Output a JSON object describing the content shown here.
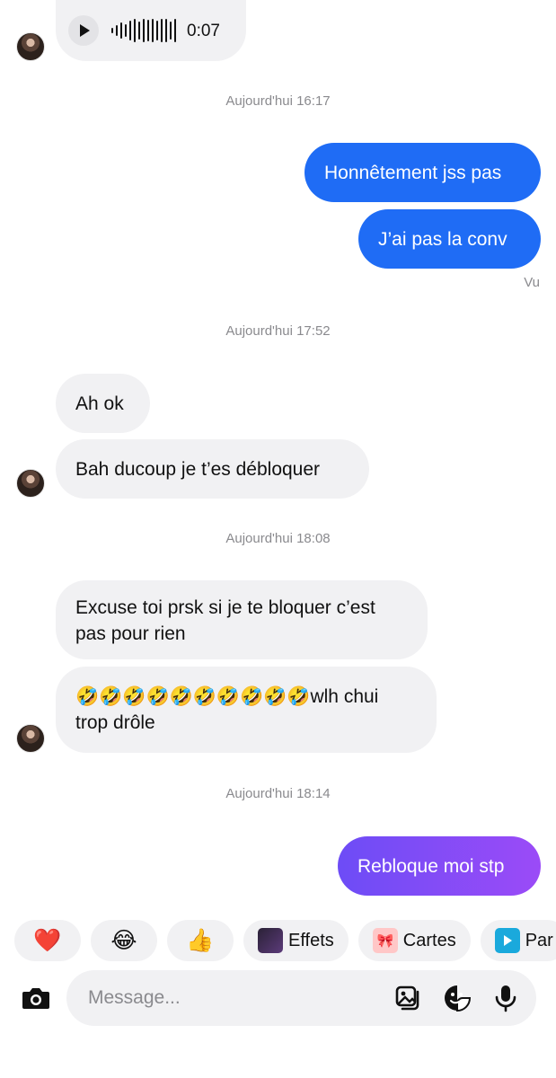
{
  "voice_message": {
    "duration": "0:07"
  },
  "timestamps": [
    "Aujourd'hui 16:17",
    "Aujourd'hui 17:52",
    "Aujourd'hui 18:08",
    "Aujourd'hui 18:14"
  ],
  "messages": {
    "m1": "Honnêtement jss pas",
    "m2": "J’ai pas la conv",
    "seen": "Vu",
    "m3": "Ah ok",
    "m4": "Bah ducoup je t’es débloquer",
    "m5_line1": "Excuse toi prsk si je te bloquer c’est",
    "m5_line2": "pas pour rien",
    "m6_line1": "🤣🤣🤣🤣🤣🤣🤣🤣🤣🤣wlh chui",
    "m6_line2": "trop drôle",
    "m7": "Rebloque moi stp"
  },
  "reactions": {
    "heart": "❤️",
    "laugh": "😂",
    "thumbs": "👍",
    "effets": "Effets",
    "cartes": "Cartes",
    "par": "Par"
  },
  "composer": {
    "placeholder": "Message...",
    "icons": [
      "camera-icon",
      "gallery-icon",
      "sticker-icon",
      "mic-icon"
    ]
  },
  "colors": {
    "outgoing": "#1f6cf5",
    "outgoing_gradient_start": "#6d4cf6",
    "outgoing_gradient_end": "#9b4bf7",
    "incoming": "#f1f1f3",
    "meta_text": "#8a8a8e"
  }
}
